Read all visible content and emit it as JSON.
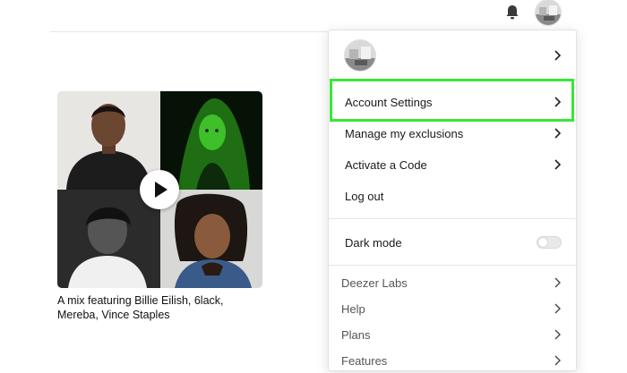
{
  "header": {
    "notifications_icon": "bell-icon",
    "avatar_icon": "user-avatar"
  },
  "mix": {
    "caption": "A mix featuring Billie Eilish, 6lack, Mereba, Vince Staples",
    "play_icon": "play-icon"
  },
  "menu": {
    "profile_icon": "user-avatar",
    "items": [
      {
        "label": "Account Settings",
        "highlighted": true
      },
      {
        "label": "Manage my exclusions"
      },
      {
        "label": "Activate a Code"
      },
      {
        "label": "Log out"
      }
    ],
    "dark_mode": {
      "label": "Dark mode",
      "enabled": false
    },
    "secondary_items": [
      {
        "label": "Deezer Labs"
      },
      {
        "label": "Help"
      },
      {
        "label": "Plans"
      },
      {
        "label": "Features"
      }
    ]
  },
  "colors": {
    "highlight": "#39e639",
    "divider": "#e6e6e6"
  }
}
